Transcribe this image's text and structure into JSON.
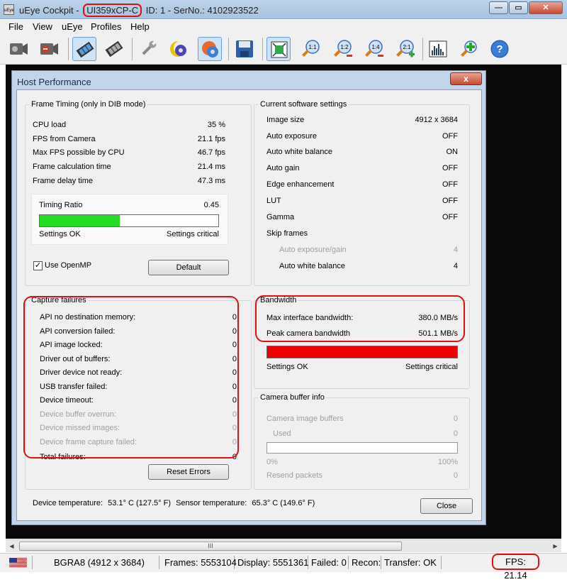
{
  "window": {
    "app_name": "uEye Cockpit",
    "separator": "-",
    "model": "UI359xCP-C",
    "id_serial": "ID: 1 - SerNo.: 4102923522",
    "icon_label": "uEye"
  },
  "menu": [
    "File",
    "View",
    "uEye",
    "Profiles",
    "Help"
  ],
  "toolbar": {
    "icons": [
      "camera-open-icon",
      "camera-close-icon",
      "live-video-icon",
      "freeze-frame-icon",
      "properties-wrench-icon",
      "settings-cog-moon-icon",
      "settings-cog-ball-icon",
      "save-disk-icon",
      "fit-window-icon",
      "zoom-1-1-icon",
      "zoom-1-2-icon",
      "zoom-1-4-icon",
      "zoom-2-1-icon",
      "histogram-icon",
      "magnifier-plus-icon",
      "help-icon"
    ],
    "zoom_labels": {
      "z11": "1:1",
      "z12": "1:2",
      "z14": "1:4",
      "z21": "2:1"
    },
    "help_label": "?"
  },
  "dialog": {
    "title": "Host Performance",
    "close_label": "x",
    "frame_timing": {
      "title": "Frame Timing (only in DIB mode)",
      "rows": [
        {
          "label": "CPU load",
          "value": "35 %"
        },
        {
          "label": "FPS from Camera",
          "value": "21.1 fps"
        },
        {
          "label": "Max FPS possible by CPU",
          "value": "46.7 fps"
        },
        {
          "label": "Frame calculation time",
          "value": "21.4 ms"
        },
        {
          "label": "Frame delay time",
          "value": "47.3 ms"
        }
      ],
      "ratio_label": "Timing Ratio",
      "ratio_value": "0.45",
      "ratio_fraction": 0.45,
      "ok_label": "Settings OK",
      "critical_label": "Settings critical",
      "openmp_label": "Use OpenMP",
      "openmp_checked": "✓",
      "default_button": "Default"
    },
    "software_settings": {
      "title": "Current software settings",
      "rows": [
        {
          "label": "Image size",
          "value": "4912 x 3684"
        },
        {
          "label": "Auto exposure",
          "value": "OFF"
        },
        {
          "label": "Auto white balance",
          "value": "ON"
        },
        {
          "label": "Auto gain",
          "value": "OFF"
        },
        {
          "label": "Edge enhancement",
          "value": "OFF"
        },
        {
          "label": "LUT",
          "value": "OFF"
        },
        {
          "label": "Gamma",
          "value": "OFF"
        }
      ],
      "skip_frames_label": "Skip frames",
      "skip_rows": [
        {
          "label": "Auto exposure/gain",
          "value": "4"
        },
        {
          "label": "Auto white balance",
          "value": "4"
        }
      ]
    },
    "capture_failures": {
      "title": "Capture failures",
      "rows": [
        {
          "label": "API no destination memory:",
          "value": "0"
        },
        {
          "label": "API conversion failed:",
          "value": "0"
        },
        {
          "label": "API image locked:",
          "value": "0"
        },
        {
          "label": "Driver out of buffers:",
          "value": "0"
        },
        {
          "label": "Driver device not ready:",
          "value": "0"
        },
        {
          "label": "USB transfer failed:",
          "value": "0"
        },
        {
          "label": "Device timeout:",
          "value": "0"
        },
        {
          "label": "Device buffer overrun:",
          "value": "0"
        },
        {
          "label": "Device missed images:",
          "value": "0"
        },
        {
          "label": "Device frame capture failed:",
          "value": "0"
        },
        {
          "label": "Total failures:",
          "value": "0"
        }
      ],
      "reset_button": "Reset Errors"
    },
    "bandwidth": {
      "title": "Bandwidth",
      "rows": [
        {
          "label": "Max interface bandwidth:",
          "value": "380.0 MB/s"
        },
        {
          "label": "Peak camera bandwidth",
          "value": "501.1 MB/s"
        }
      ],
      "usage_fraction": 1.0,
      "bar_color": "#ee0000",
      "ok_label": "Settings OK",
      "critical_label": "Settings critical"
    },
    "buffer_info": {
      "title": "Camera buffer info",
      "image_buffers_label": "Camera image buffers",
      "image_buffers_value": "0",
      "used_label": "Used",
      "used_value": "0",
      "used_fraction": 0,
      "pct_min": "0%",
      "pct_max": "100%",
      "resend_label": "Resend packets",
      "resend_value": "0"
    },
    "temperatures": {
      "device_label": "Device temperature:",
      "device_value": "53.1° C  (127.5° F)",
      "sensor_label": "Sensor temperature:",
      "sensor_value": "65.3° C  (149.6° F)"
    },
    "close_button": "Close"
  },
  "scrollbar": {
    "grip": "III"
  },
  "statusbar": {
    "format": "BGRA8 (4912 x 3684)",
    "frames": "Frames: 5553104",
    "display": "Display: 5551361",
    "failed": "Failed: 0",
    "recon": "Recon:",
    "transfer": "Transfer: OK",
    "fps": "FPS: 21.14"
  },
  "colors": {
    "accent_red": "#e01010",
    "timing_green": "#22dd22",
    "bandwidth_red": "#ee0000"
  }
}
